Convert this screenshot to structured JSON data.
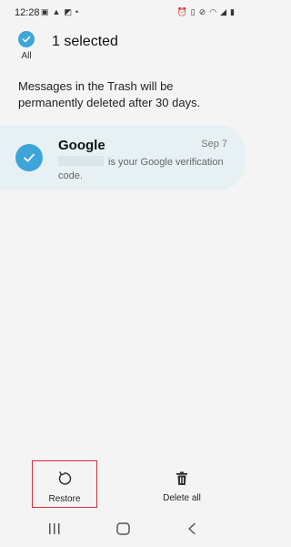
{
  "status_bar": {
    "time": "12:28",
    "left_icons": [
      "image-icon",
      "warning-icon",
      "cast-icon",
      "dot-icon"
    ],
    "right_icons": [
      "alarm-icon",
      "vibrate-icon",
      "mute-icon",
      "wifi-icon",
      "signal-icon",
      "battery-icon"
    ]
  },
  "header": {
    "select_all_label": "All",
    "selected_count": "1 selected"
  },
  "notice": "Messages in the Trash will be permanently deleted after 30 days.",
  "messages": [
    {
      "sender": "Google",
      "date": "Sep 7",
      "preview": " is your Google verification code.",
      "selected": true
    }
  ],
  "bottom_actions": {
    "restore_label": "Restore",
    "delete_all_label": "Delete all"
  },
  "colors": {
    "accent": "#3da5d8",
    "card_bg": "#e7f1f4",
    "highlight_border": "#c7313a"
  }
}
